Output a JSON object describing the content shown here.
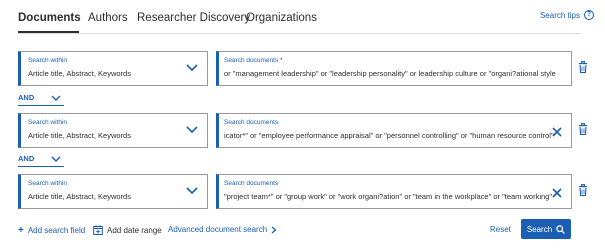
{
  "tabs": [
    {
      "label": "Documents",
      "active": true
    },
    {
      "label": "Authors",
      "active": false
    },
    {
      "label": "Researcher Discovery",
      "active": false
    },
    {
      "label": "Organizations",
      "active": false
    }
  ],
  "search_tips": "Search tips",
  "rows": [
    {
      "within_label": "Search within",
      "within_value": "Article title, Abstract, Keywords",
      "query_label": "Search documents",
      "query_required": "*",
      "query_value": "or \"management leadership\" or \"leadership personality\" or leadership culture or \"organi?ational style"
    },
    {
      "within_label": "Search within",
      "within_value": "Article title, Abstract, Keywords",
      "query_label": "Search documents",
      "query_value": "icator*\" or \"employee performance appraisal\" or \"personnel controlling\" or \"human resource control\""
    },
    {
      "within_label": "Search within",
      "within_value": "Article title, Abstract, Keywords",
      "query_label": "Search documents",
      "query_value": "\"project team*\" or \"group work\" or \"work organi?ation\" or \"team in the workplace\" or \"team working\""
    }
  ],
  "operators": [
    "AND",
    "AND"
  ],
  "bottom": {
    "add_field": "Add search field",
    "add_date": "Add date range",
    "advanced": "Advanced document search",
    "reset": "Reset",
    "search": "Search"
  },
  "colors": {
    "accent": "#1a5fb4",
    "required": "#c8102e"
  }
}
